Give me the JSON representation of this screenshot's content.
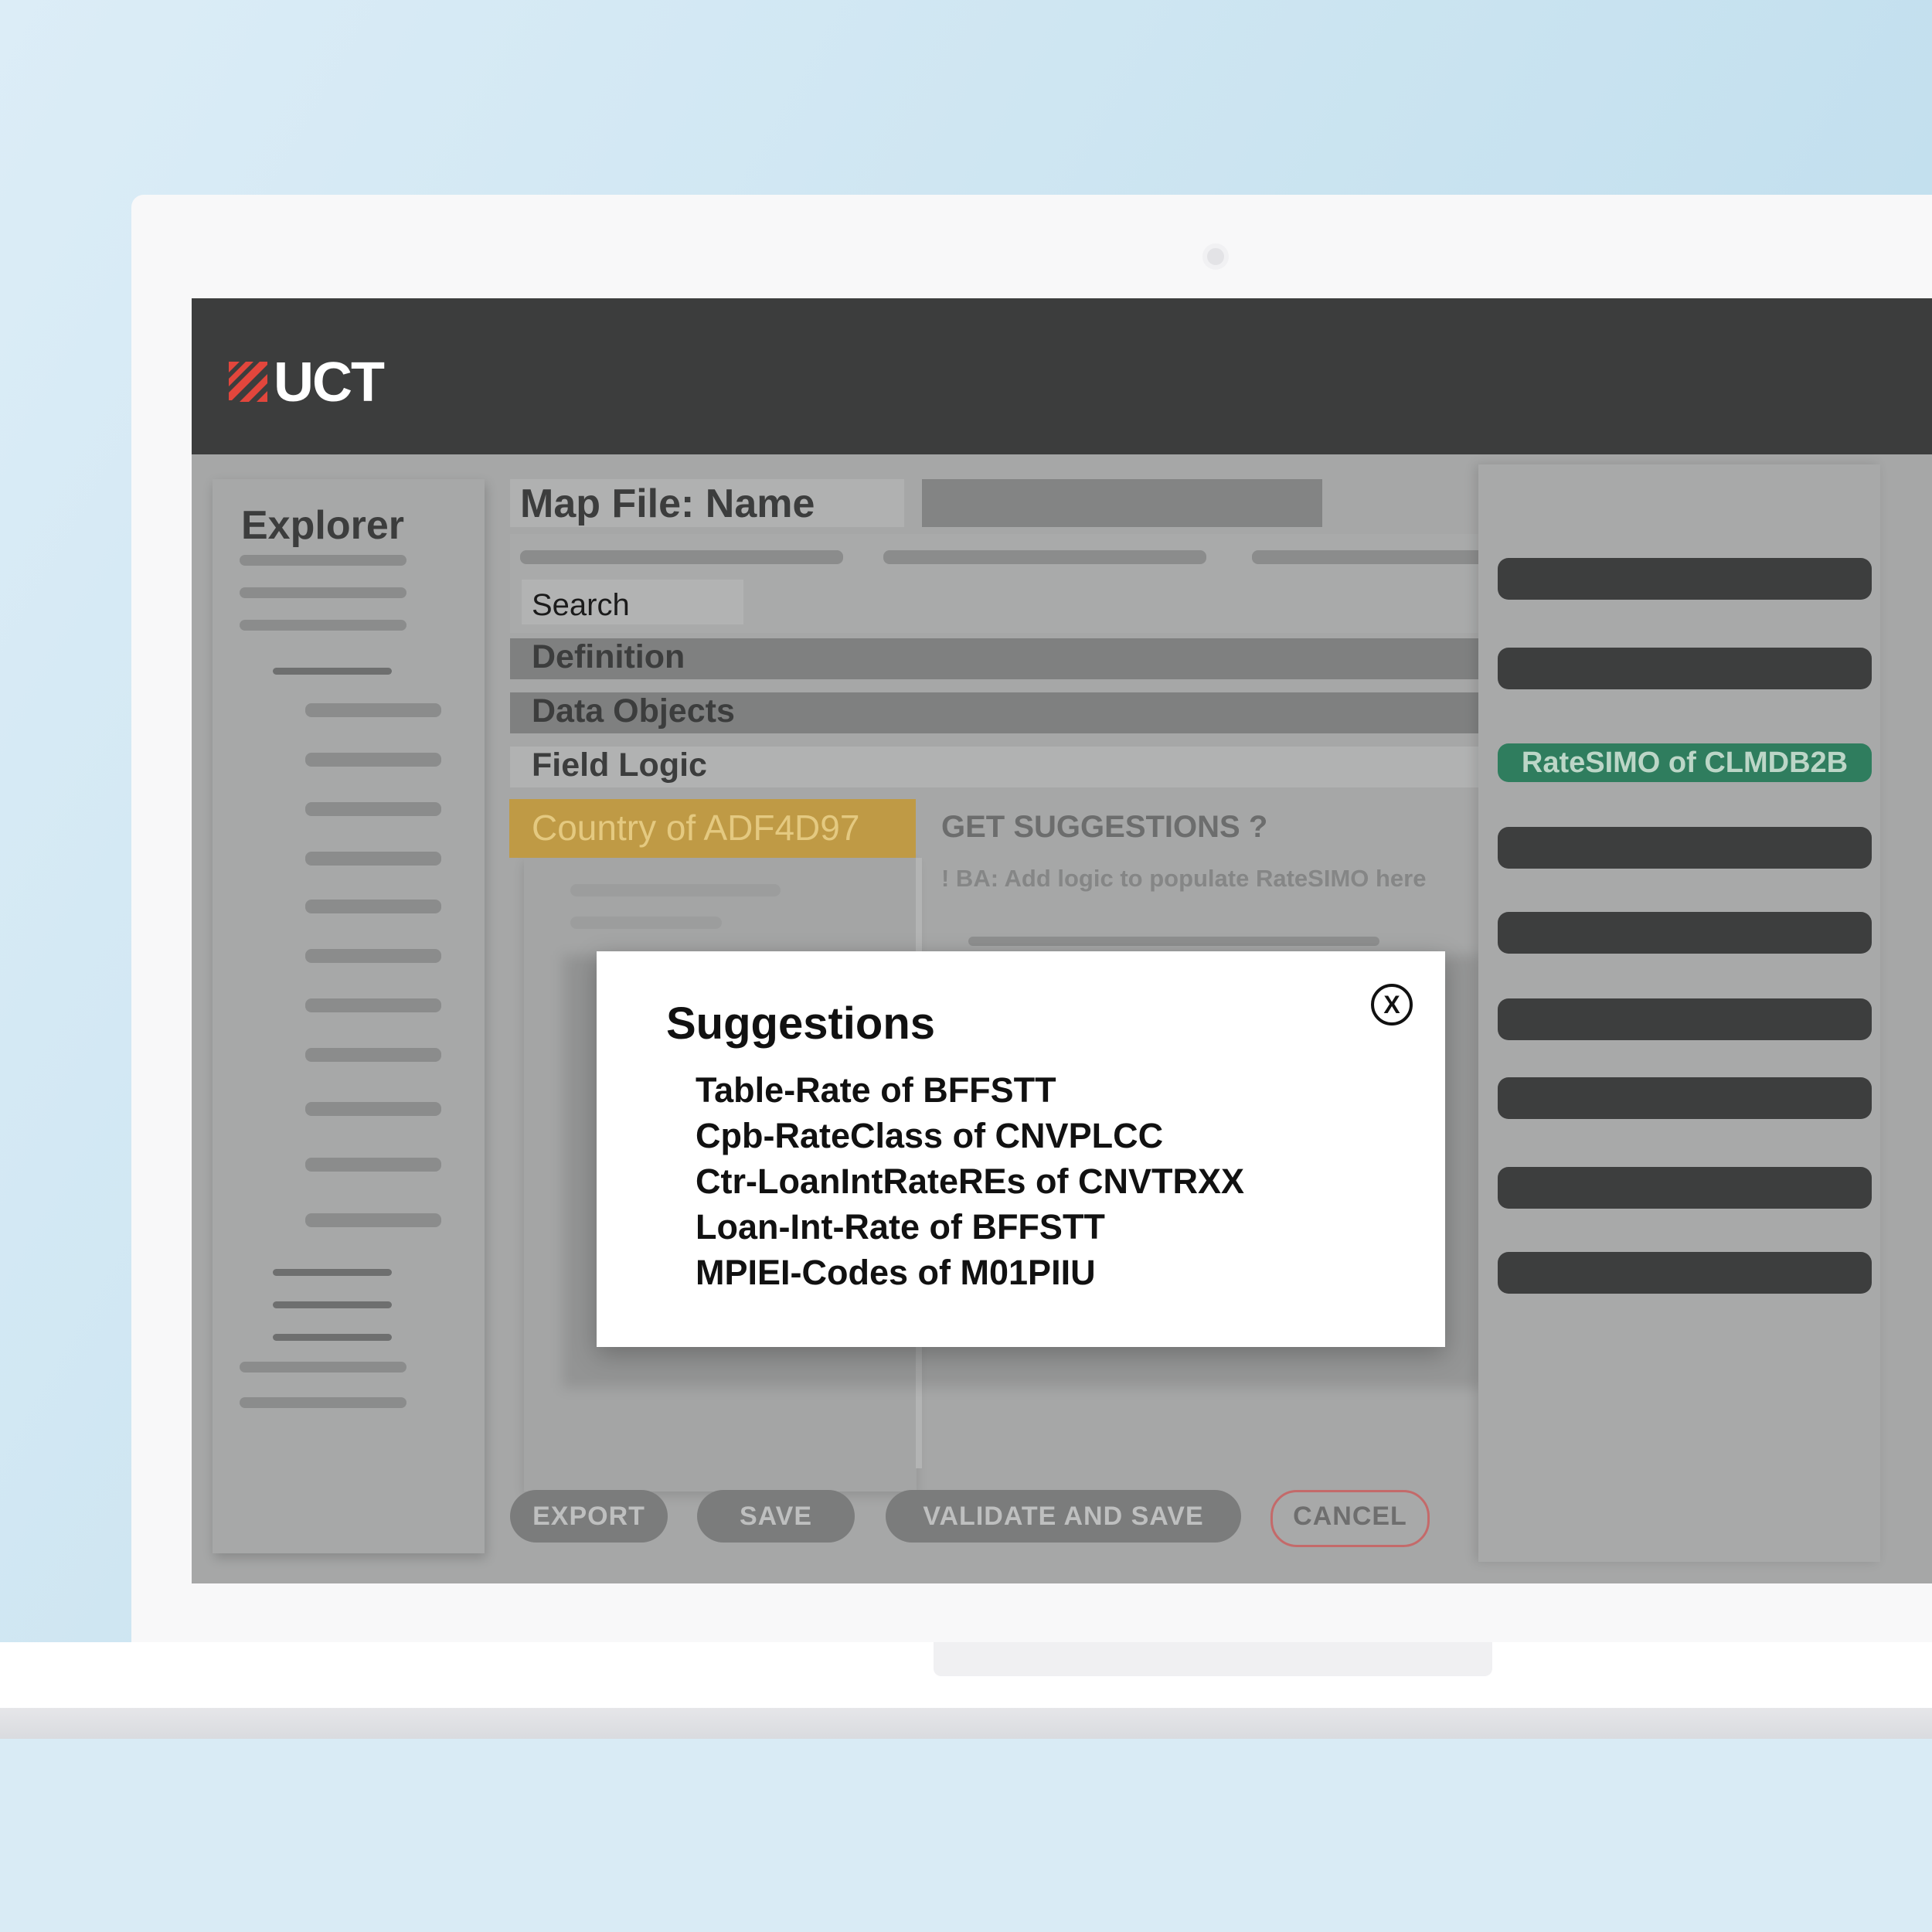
{
  "app": {
    "logo_text": "UCT",
    "brand_color": "#e2463c"
  },
  "sidebar": {
    "title": "Explorer"
  },
  "main": {
    "title": "Map File: Name",
    "search_label": "Search",
    "sections": [
      "Definition",
      "Data Objects",
      "Field Logic"
    ],
    "selected_field": "Country of ADF4D97",
    "get_suggestions_label": "GET SUGGESTIONS ?",
    "logic_note": "! BA: Add logic to populate RateSIMO here"
  },
  "actions": {
    "export": "EXPORT",
    "save": "SAVE",
    "validate_and_save": "VALIDATE AND SAVE",
    "cancel": "CANCEL"
  },
  "right_panel": {
    "highlighted_item": "RateSIMO of CLMDB2B",
    "highlight_color": "#2f7d5e"
  },
  "modal": {
    "title": "Suggestions",
    "close_label": "X",
    "items": [
      "Table-Rate of BFFSTT",
      "Cpb-RateClass of CNVPLCC",
      "Ctr-LoanIntRateREs of CNVTRXX",
      "Loan-Int-Rate of BFFSTT",
      "MPIEI-Codes of M01PIIU"
    ]
  },
  "icons": {
    "logo": "uct-logo-icon",
    "close": "close-icon"
  }
}
